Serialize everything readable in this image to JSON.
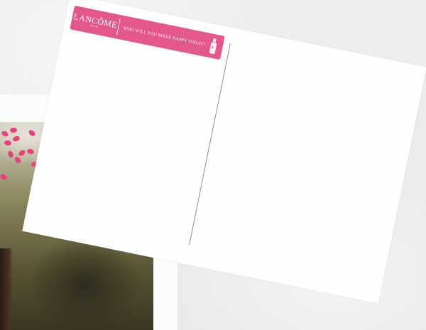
{
  "postcard": {
    "brand_name": "LANCÔME",
    "brand_sub": "PARIS",
    "slogan": "WHO WILL YOU MAKE HAPPY TODAY?",
    "banner_color": "#e3578a"
  },
  "background_photo": {
    "petal_color": "#e0457b"
  }
}
